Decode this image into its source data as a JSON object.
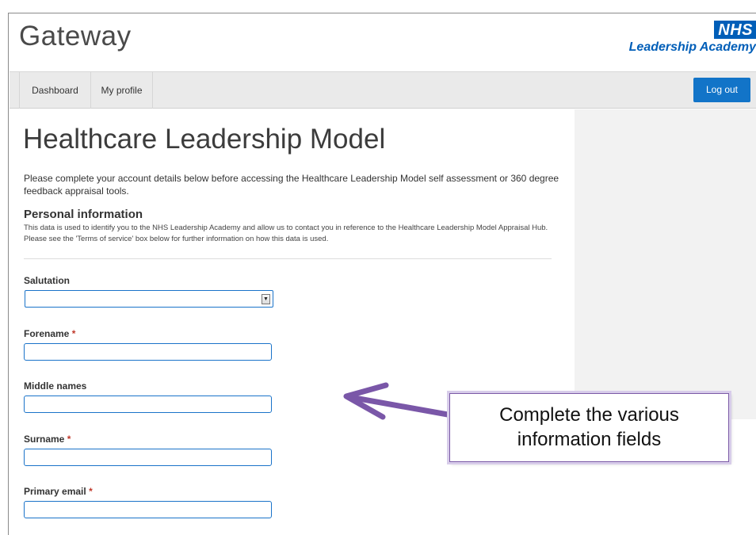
{
  "header": {
    "site_title": "Gateway",
    "logo_badge": "NHS",
    "logo_subtitle": "Leadership Academy"
  },
  "nav": {
    "items": [
      {
        "label": "Dashboard"
      },
      {
        "label": "My profile"
      }
    ],
    "logout_label": "Log out"
  },
  "main": {
    "title": "Healthcare Leadership Model",
    "intro": "Please complete your account details below before accessing the Healthcare Leadership Model self assessment or 360 degree feedback appraisal tools.",
    "section": {
      "title": "Personal information",
      "description": "This data is used to identify you to the NHS Leadership Academy and allow us to contact you in reference to the Healthcare Leadership Model Appraisal Hub. Please see the 'Terms of service' box below for further information on how this data is used."
    },
    "fields": {
      "salutation": {
        "label": "Salutation",
        "value": ""
      },
      "forename": {
        "label": "Forename",
        "required": "*",
        "value": ""
      },
      "middle_names": {
        "label": "Middle names",
        "value": ""
      },
      "surname": {
        "label": "Surname",
        "required": "*",
        "value": ""
      },
      "primary_email": {
        "label": "Primary email",
        "required": "*",
        "value": ""
      }
    }
  },
  "callout": {
    "text": "Complete the various information fields"
  },
  "colors": {
    "nhs_blue": "#005eb8",
    "button_blue": "#1274c8",
    "callout_border": "#7b5aa6",
    "arrow": "#7a57a8"
  },
  "icons": {
    "select_arrow": "chevron-down-icon",
    "callout_arrow": "arrow-left-icon"
  }
}
